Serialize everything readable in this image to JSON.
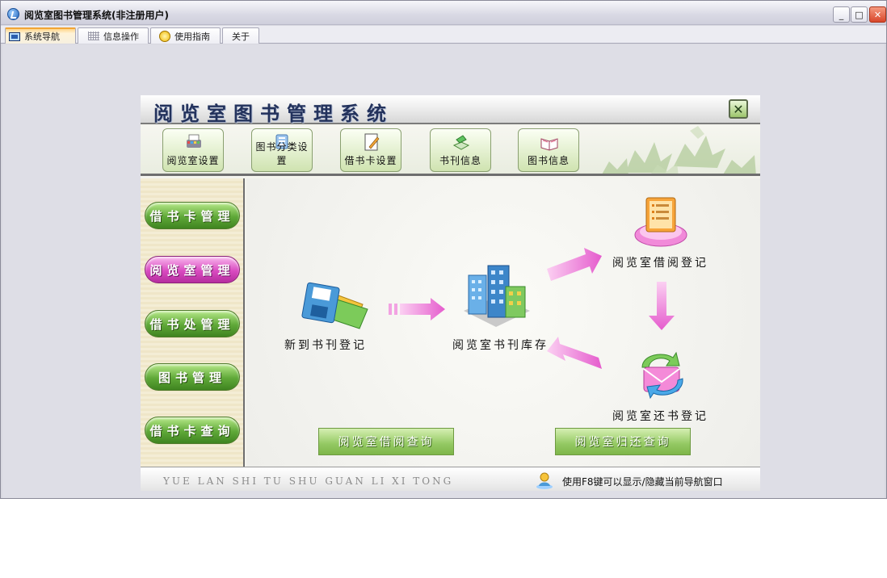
{
  "window": {
    "title": "阅览室图书管理系统(非注册用户)",
    "controls": {
      "minimize": "_",
      "maximize": "□",
      "close": "✕"
    }
  },
  "tabs": [
    {
      "label": "系统导航",
      "icon": "monitor-icon",
      "active": true
    },
    {
      "label": "信息操作",
      "icon": "grid-icon",
      "active": false
    },
    {
      "label": "使用指南",
      "icon": "help-icon",
      "active": false
    },
    {
      "label": "关于",
      "icon": "",
      "active": false
    }
  ],
  "panel": {
    "title": "阅览室图书管理系统",
    "close_label": "✕",
    "toolbar": [
      {
        "label": "阅览室设置",
        "icon": "printer-icon"
      },
      {
        "label": "图书分类设置",
        "icon": "classify-icon"
      },
      {
        "label": "借书卡设置",
        "icon": "card-edit-icon"
      },
      {
        "label": "书刊信息",
        "icon": "journal-icon"
      },
      {
        "label": "图书信息",
        "icon": "open-book-icon"
      }
    ],
    "sidebar": [
      {
        "label": "借书卡管理",
        "highlight": false
      },
      {
        "label": "阅览室管理",
        "highlight": true
      },
      {
        "label": "借书处管理",
        "highlight": false
      },
      {
        "label": "图书管理",
        "highlight": false
      },
      {
        "label": "借书卡查询",
        "highlight": false
      }
    ],
    "flow": {
      "new_register": "新到书刊登记",
      "stock": "阅览室书刊库存",
      "borrow_register": "阅览室借阅登记",
      "return_register": "阅览室还书登记"
    },
    "queries": {
      "borrow_query": "阅览室借阅查询",
      "return_query": "阅览室归还查询"
    },
    "footer": {
      "pinyin": "YUE LAN SHI TU SHU GUAN LI XI TONG",
      "hint": "使用F8键可以显示/隐藏当前导航窗口"
    }
  },
  "colors": {
    "accent_green": "#5fa838",
    "accent_pink": "#d94bc0",
    "arrow_pink": "#ec74d8",
    "title_blue": "#23325c"
  }
}
